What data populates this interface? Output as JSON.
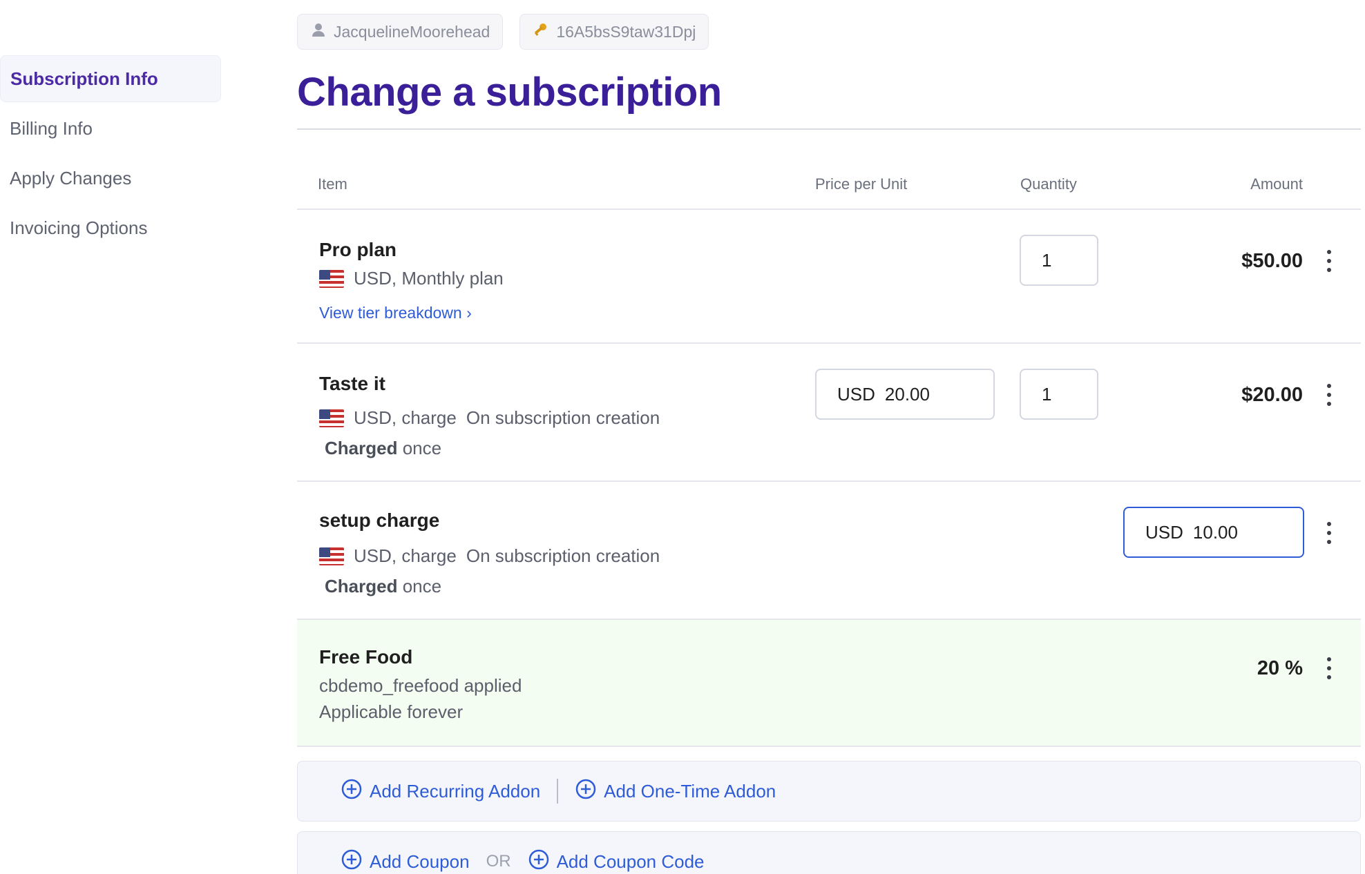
{
  "sidebar": {
    "items": [
      {
        "label": "Subscription Info",
        "active": true
      },
      {
        "label": "Billing Info"
      },
      {
        "label": "Apply Changes"
      },
      {
        "label": "Invoicing Options"
      }
    ]
  },
  "header": {
    "customer_chip": "JacquelineMoorehead",
    "id_chip": "16A5bsS9taw31Dpj",
    "title": "Change a subscription"
  },
  "table": {
    "headers": {
      "item": "Item",
      "price": "Price per Unit",
      "quantity": "Quantity",
      "amount": "Amount"
    },
    "rows": [
      {
        "name": "Pro plan",
        "sub": "USD, Monthly plan",
        "link": "View tier breakdown ›",
        "quantity": "1",
        "amount": "$50.00"
      },
      {
        "name": "Taste it",
        "sub": "USD, charge",
        "sub2": "On subscription creation",
        "charged_bold": "Charged",
        "charged_rest": "once",
        "price_currency": "USD",
        "price_value": "20.00",
        "quantity": "1",
        "amount": "$20.00"
      },
      {
        "name": "setup charge",
        "sub": "USD, charge",
        "sub2": "On subscription creation",
        "charged_bold": "Charged",
        "charged_rest": "once",
        "amount_currency": "USD",
        "amount_value": "10.00"
      },
      {
        "name": "Free Food",
        "line1": "cbdemo_freefood applied",
        "line2": "Applicable forever",
        "amount": "20 %"
      }
    ]
  },
  "actions": {
    "add_recurring": "Add Recurring Addon",
    "add_one_time": "Add One-Time Addon",
    "add_coupon": "Add Coupon",
    "or": "OR",
    "add_coupon_code": "Add Coupon Code"
  },
  "colors": {
    "accent": "#3b1f99",
    "link": "#2e5bd6",
    "discount_bg": "#f3fdf1"
  }
}
